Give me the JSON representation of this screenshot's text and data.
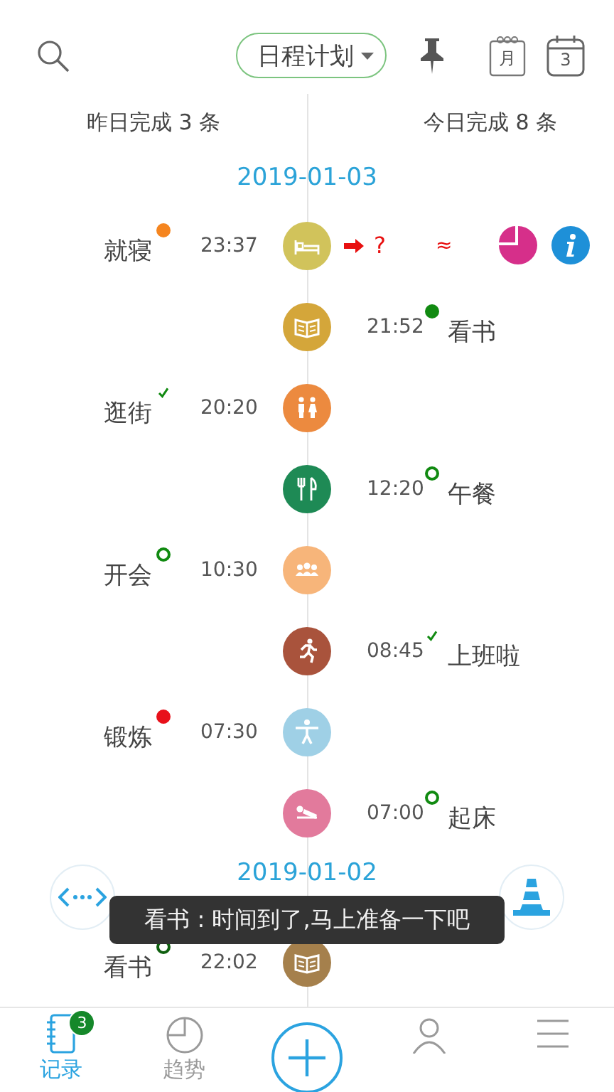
{
  "header": {
    "view_menu": "日程计划",
    "month_icon": "月",
    "day_icon": "3"
  },
  "summary": {
    "yesterday": "昨日完成 3 条",
    "today": "今日完成 8 条"
  },
  "days": [
    {
      "date": "2019-01-03",
      "entries": [
        {
          "kind": "bed",
          "color": "#d1c35b",
          "yesterday": {
            "name": "就寝",
            "time": "23:37",
            "status": {
              "kind": "dot",
              "color": "#f5851f"
            }
          },
          "extras": {
            "question": "?",
            "wave": "≈"
          }
        },
        {
          "kind": "book",
          "color": "#d4a63a",
          "today": {
            "name": "看书",
            "time": "21:52",
            "status": {
              "kind": "dot",
              "color": "#118a11"
            }
          }
        },
        {
          "kind": "restroom",
          "color": "#ec8a3f",
          "yesterday": {
            "name": "逛街",
            "time": "20:20",
            "status": {
              "kind": "check",
              "color": "#118a11"
            }
          }
        },
        {
          "kind": "meal",
          "color": "#1e8a55",
          "today": {
            "name": "午餐",
            "time": "12:20",
            "status": {
              "kind": "ring",
              "color": "#118a11"
            }
          }
        },
        {
          "kind": "meeting",
          "color": "#f7b57a",
          "yesterday": {
            "name": "开会",
            "time": "10:30",
            "status": {
              "kind": "ring",
              "color": "#118a11"
            }
          }
        },
        {
          "kind": "run",
          "color": "#a9533c",
          "today": {
            "name": "上班啦",
            "time": "08:45",
            "status": {
              "kind": "check",
              "color": "#118a11"
            }
          }
        },
        {
          "kind": "exercise",
          "color": "#9fd0e6",
          "yesterday": {
            "name": "锻炼",
            "time": "07:30",
            "status": {
              "kind": "dot",
              "color": "#e8101a"
            }
          }
        },
        {
          "kind": "wake",
          "color": "#e27a9c",
          "today": {
            "name": "起床",
            "time": "07:00",
            "status": {
              "kind": "ring",
              "color": "#118a11"
            }
          }
        }
      ]
    },
    {
      "date": "2019-01-02",
      "entries": [
        {
          "kind": "book",
          "color": "#a5804c",
          "yesterday": {
            "name": "看书",
            "time": "22:02",
            "status": {
              "kind": "ring",
              "color": "#0f5f0f"
            }
          }
        }
      ]
    }
  ],
  "toast": "看书 : 时间到了,马上准备一下吧",
  "nav": {
    "tabs": [
      {
        "label": "记录",
        "selected": true,
        "kind": "notebook",
        "badge": "3"
      },
      {
        "label": "趋势",
        "selected": false,
        "kind": "chart"
      }
    ]
  }
}
